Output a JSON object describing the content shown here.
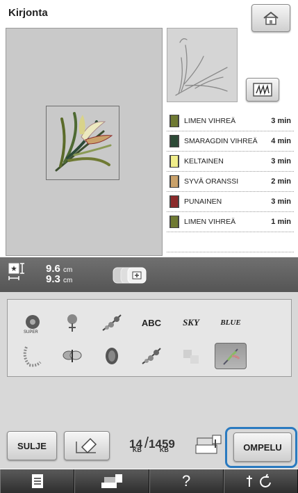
{
  "screen": {
    "title": "Kirjonta"
  },
  "thread_list": [
    {
      "name": "LIMEN VIHREÄ",
      "time": "3 min",
      "color": "#6f7a33"
    },
    {
      "name": "SMARAGDIN VIHREÄ",
      "time": "4 min",
      "color": "#2c4a36"
    },
    {
      "name": "KELTAINEN",
      "time": "3 min",
      "color": "#f0ed8a"
    },
    {
      "name": "SYVÄ ORANSSI",
      "time": "2 min",
      "color": "#c9a16a"
    },
    {
      "name": "PUNAINEN",
      "time": "3 min",
      "color": "#8b2a2a"
    },
    {
      "name": "LIMEN VIHREÄ",
      "time": "1 min",
      "color": "#6f7a33"
    }
  ],
  "size": {
    "width_value": "9.6",
    "height_value": "9.3",
    "unit": "cm"
  },
  "pattern_tiles": {
    "row1": [
      "flower-pattern",
      "rose-pattern",
      "leaf-branch-pattern",
      "ABC",
      "SKY",
      "BLUE"
    ],
    "row2": [
      "lace-pattern",
      "butterfly-pattern",
      "oval-medallion-pattern",
      "leaf-branch-pattern",
      "puzzle-pattern",
      "selected-pattern"
    ],
    "selected_index": 11
  },
  "footer": {
    "close_label": "SULJE",
    "memory_used": "14",
    "memory_used_unit": "KB",
    "memory_total": "1459",
    "memory_total_unit": "KB",
    "sew_label": "OMPELU"
  },
  "taskbar": [
    "page-icon",
    "machine-icon",
    "?",
    "needle-rotate-icon"
  ]
}
